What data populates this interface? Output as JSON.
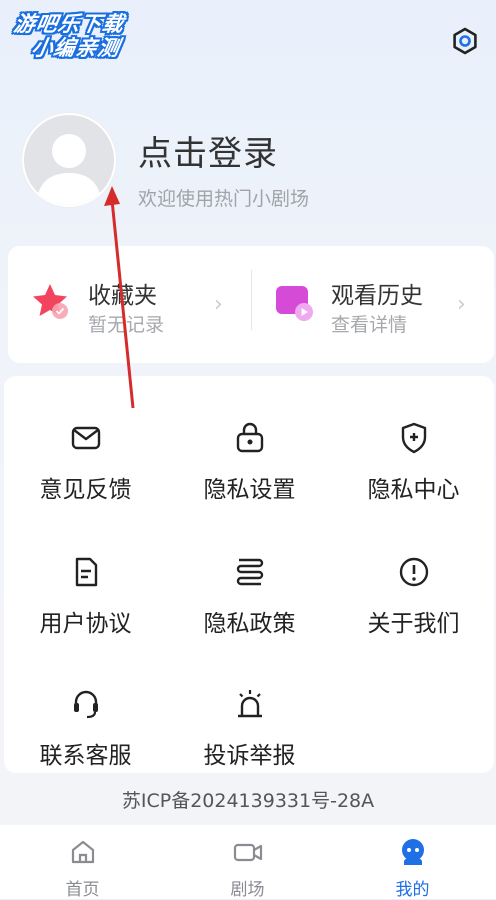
{
  "watermark": {
    "line1": "游吧乐下载",
    "line2": "小编亲测"
  },
  "header": {
    "settings_icon": "settings-hex-icon"
  },
  "profile": {
    "title": "点击登录",
    "subtitle": "欢迎使用热门小剧场"
  },
  "quick": [
    {
      "label": "收藏夹",
      "sub": "暂无记录",
      "icon": "favorites-star-icon"
    },
    {
      "label": "观看历史",
      "sub": "查看详情",
      "icon": "history-video-icon"
    }
  ],
  "menu": [
    {
      "label": "意见反馈",
      "icon": "mail-icon"
    },
    {
      "label": "隐私设置",
      "icon": "lock-icon"
    },
    {
      "label": "隐私中心",
      "icon": "shield-icon"
    },
    {
      "label": "用户协议",
      "icon": "document-icon"
    },
    {
      "label": "隐私政策",
      "icon": "policy-scroll-icon"
    },
    {
      "label": "关于我们",
      "icon": "info-circle-icon"
    },
    {
      "label": "联系客服",
      "icon": "headset-icon"
    },
    {
      "label": "投诉举报",
      "icon": "alarm-icon"
    }
  ],
  "icp": "苏ICP备2024139331号-28A",
  "tabs": [
    {
      "label": "首页",
      "icon": "home-icon"
    },
    {
      "label": "剧场",
      "icon": "video-camera-icon"
    },
    {
      "label": "我的",
      "icon": "mine-icon"
    }
  ],
  "colors": {
    "accent": "#1f6fe5",
    "annotation_arrow": "#d62b2b"
  }
}
